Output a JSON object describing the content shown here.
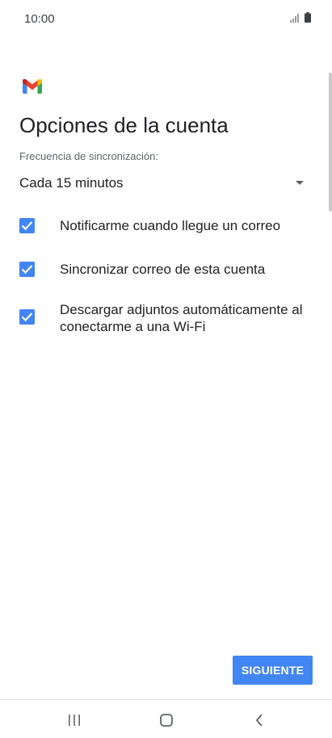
{
  "status_bar": {
    "time": "10:00",
    "icons": [
      "signal-icon",
      "battery-icon"
    ]
  },
  "app": {
    "logo": "gmail-logo",
    "colors": {
      "accent": "#4285f4",
      "checkbox": "#4285f4"
    }
  },
  "page": {
    "title": "Opciones de la cuenta"
  },
  "sync": {
    "label": "Frecuencia de sincronización:",
    "selected": "Cada 15 minutos"
  },
  "options": [
    {
      "label": "Notificarme cuando llegue un correo",
      "checked": true
    },
    {
      "label": "Sincronizar correo de esta cuenta",
      "checked": true
    },
    {
      "label": "Descargar adjuntos automáticamente al conectarme a una Wi-Fi",
      "checked": true
    }
  ],
  "actions": {
    "next_label": "SIGUIENTE"
  },
  "nav_bar": {
    "buttons": [
      "recent-apps-icon",
      "home-icon",
      "back-icon"
    ]
  }
}
